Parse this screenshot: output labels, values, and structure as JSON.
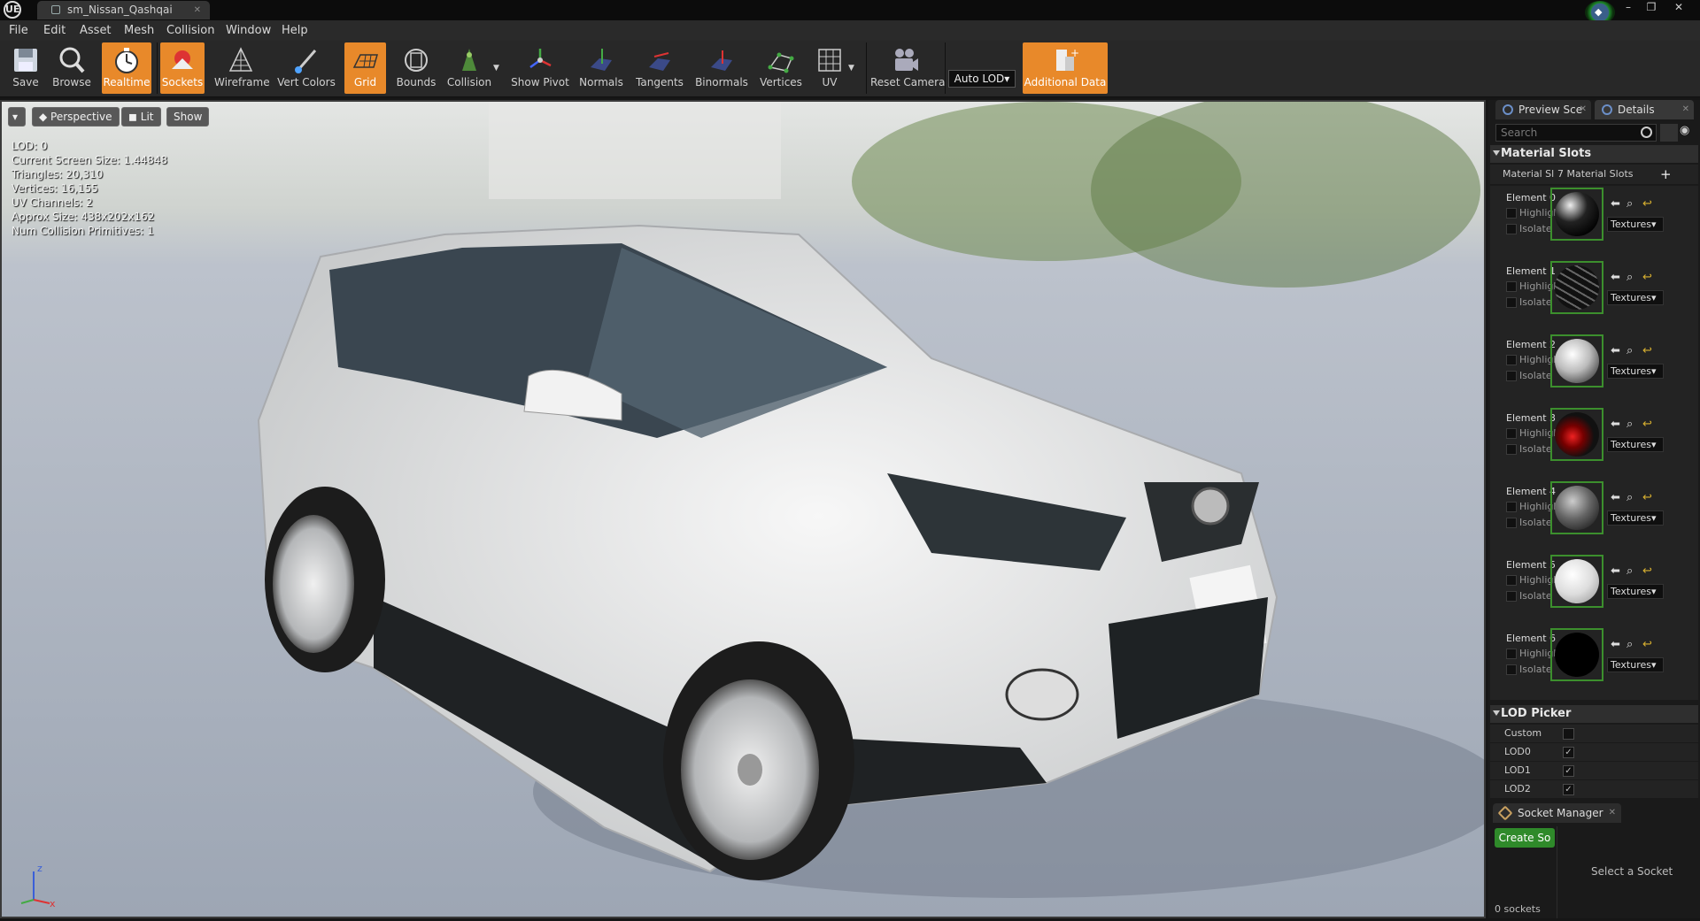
{
  "window": {
    "tab_title": "sm_Nissan_Qashqai",
    "logo": "UE",
    "minimize": "–",
    "restore": "❐",
    "close": "✕"
  },
  "menu": [
    "File",
    "Edit",
    "Asset",
    "Mesh",
    "Collision",
    "Window",
    "Help"
  ],
  "toolbar": {
    "buttons": [
      {
        "label": "Save",
        "icon": "save-icon"
      },
      {
        "label": "Browse",
        "icon": "browse-icon"
      },
      {
        "label": "Realtime",
        "icon": "realtime-icon"
      },
      {
        "label": "Sockets",
        "icon": "sockets-icon"
      },
      {
        "label": "Wireframe",
        "icon": "wireframe-icon"
      },
      {
        "label": "Vert Colors",
        "icon": "vert-colors-icon"
      },
      {
        "label": "Grid",
        "icon": "grid-icon"
      },
      {
        "label": "Bounds",
        "icon": "bounds-icon"
      },
      {
        "label": "Collision",
        "icon": "collision-icon"
      },
      {
        "label": "Show Pivot",
        "icon": "pivot-icon"
      },
      {
        "label": "Normals",
        "icon": "normals-icon"
      },
      {
        "label": "Tangents",
        "icon": "tangents-icon"
      },
      {
        "label": "Binormals",
        "icon": "binormals-icon"
      },
      {
        "label": "Vertices",
        "icon": "vertices-icon"
      },
      {
        "label": "UV",
        "icon": "uv-icon"
      },
      {
        "label": "Reset Camera",
        "icon": "camera-icon"
      },
      {
        "label": "Additional Data",
        "icon": "additional-data-icon"
      }
    ],
    "lod_dropdown": "Auto LOD▾"
  },
  "viewport": {
    "perspective": "Perspective",
    "lit": "Lit",
    "show": "Show",
    "stats": [
      "LOD:  0",
      "Current Screen Size:  1.44848",
      "Triangles:  20,310",
      "Vertices:  16,155",
      "UV Channels:  2",
      "Approx Size: 438x202x162",
      "Num Collision Primitives:  1"
    ],
    "axis_x": "x",
    "axis_z": "z"
  },
  "panel": {
    "tab_preview": "Preview Sce",
    "tab_details": "Details",
    "search_placeholder": "Search",
    "material_slots_header": "Material Slots",
    "material_slots_label": "Material Sl",
    "material_slots_count": "7 Material Slots",
    "highlight": "Highligh",
    "isolate": "Isolate",
    "textures": "Textures▾",
    "elements": [
      {
        "name": "Element 0",
        "color": "#2a2a2a"
      },
      {
        "name": "Element 1",
        "color": "#1e1e1e"
      },
      {
        "name": "Element 2",
        "color": "#c8c8c8"
      },
      {
        "name": "Element 3",
        "color": "#8a0c10"
      },
      {
        "name": "Element 4",
        "color": "#5a5a5a"
      },
      {
        "name": "Element 5",
        "color": "#dcdcdc"
      },
      {
        "name": "Element 6",
        "color": "#000000"
      }
    ],
    "lod_picker_header": "LOD Picker",
    "lod_rows": [
      {
        "label": "Custom",
        "checked": false
      },
      {
        "label": "LOD0",
        "checked": true
      },
      {
        "label": "LOD1",
        "checked": true
      },
      {
        "label": "LOD2",
        "checked": true
      }
    ]
  },
  "sockets": {
    "tab": "Socket Manager",
    "create": "Create So",
    "hint": "Select a Socket",
    "count": "0 sockets"
  },
  "colors": {
    "accent": "#e8892a",
    "create_btn": "#2f8a2a",
    "thumb_border": "#3c8f2d"
  }
}
